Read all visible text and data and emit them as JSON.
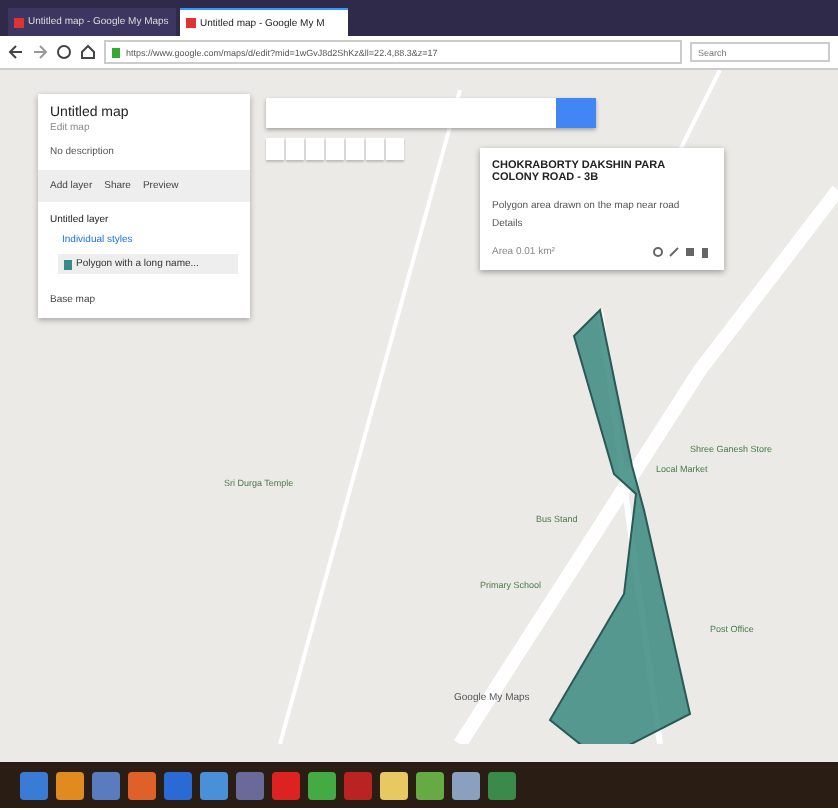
{
  "browser": {
    "tabs": [
      {
        "label": "Untitled map - Google My Maps",
        "selected": false
      },
      {
        "label": "Untitled map - Google My M",
        "selected": true
      }
    ],
    "url": "https://www.google.com/maps/d/edit?mid=1wGvJ8d2ShKz&ll=22.4,88.3&z=17",
    "search_placeholder": "Search"
  },
  "panel": {
    "title": "Untitled map",
    "subtitle": "Edit map",
    "description": "No description",
    "actions": [
      "Add layer",
      "Share",
      "Preview"
    ],
    "layer": {
      "name": "Untitled layer",
      "style": "Individual styles",
      "items": [
        {
          "label": "Polygon with a long name...",
          "selected": true
        }
      ]
    },
    "base_map": "Base map"
  },
  "popup": {
    "title": "CHOKRABORTY DAKSHIN PARA COLONY ROAD - 3B",
    "body": "Polygon area drawn on the map near road",
    "extra": "Details",
    "meta": "Area  0.01 km²"
  },
  "map": {
    "labels": [
      {
        "text": "Sri Durga Temple"
      },
      {
        "text": "Local Market"
      },
      {
        "text": "Bus Stand"
      },
      {
        "text": "Primary School"
      },
      {
        "text": "Shree Ganesh Store"
      },
      {
        "text": "Post Office"
      }
    ],
    "attribution": "Google My Maps"
  }
}
